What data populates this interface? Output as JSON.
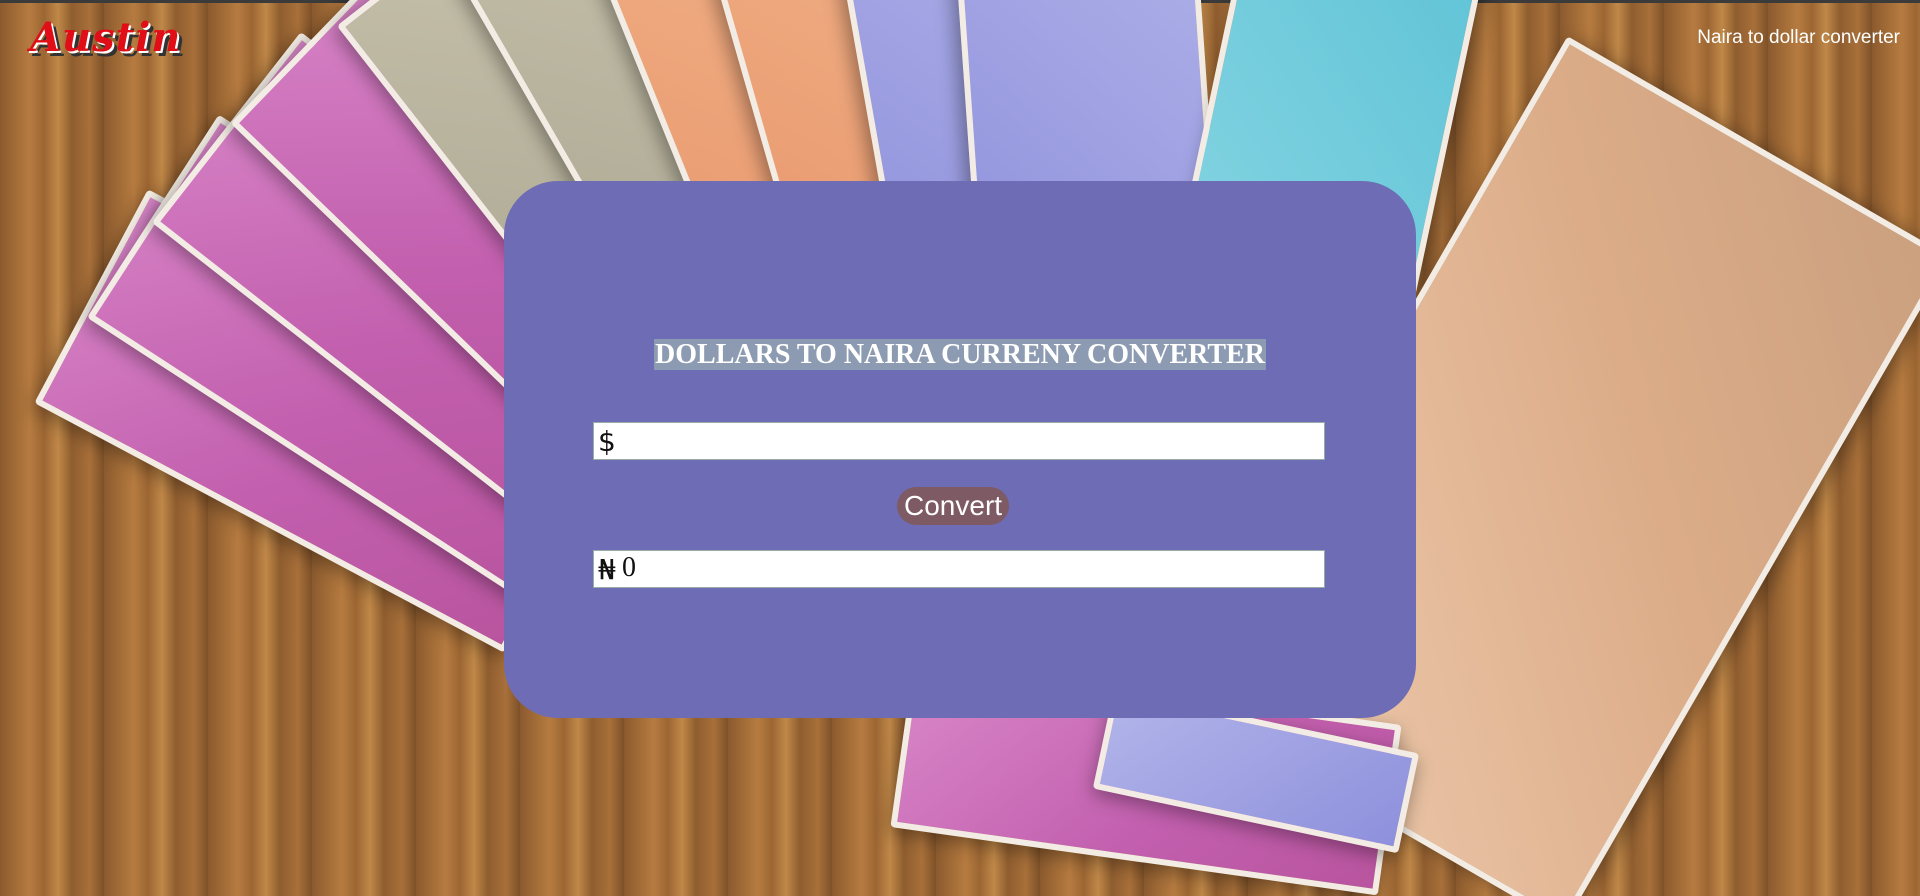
{
  "header": {
    "logo_text": "Austin",
    "nav_link": "Naira to dollar converter"
  },
  "converter": {
    "title": "DOLLARS TO NAIRA CURRENY CONVERTER",
    "dollar_symbol": "$",
    "dollar_value": "",
    "convert_label": "Convert",
    "naira_symbol": "₦",
    "naira_value": "0"
  },
  "colors": {
    "card": "#6d6cb5",
    "button": "#7e5a64",
    "logo": "#e10d17"
  }
}
